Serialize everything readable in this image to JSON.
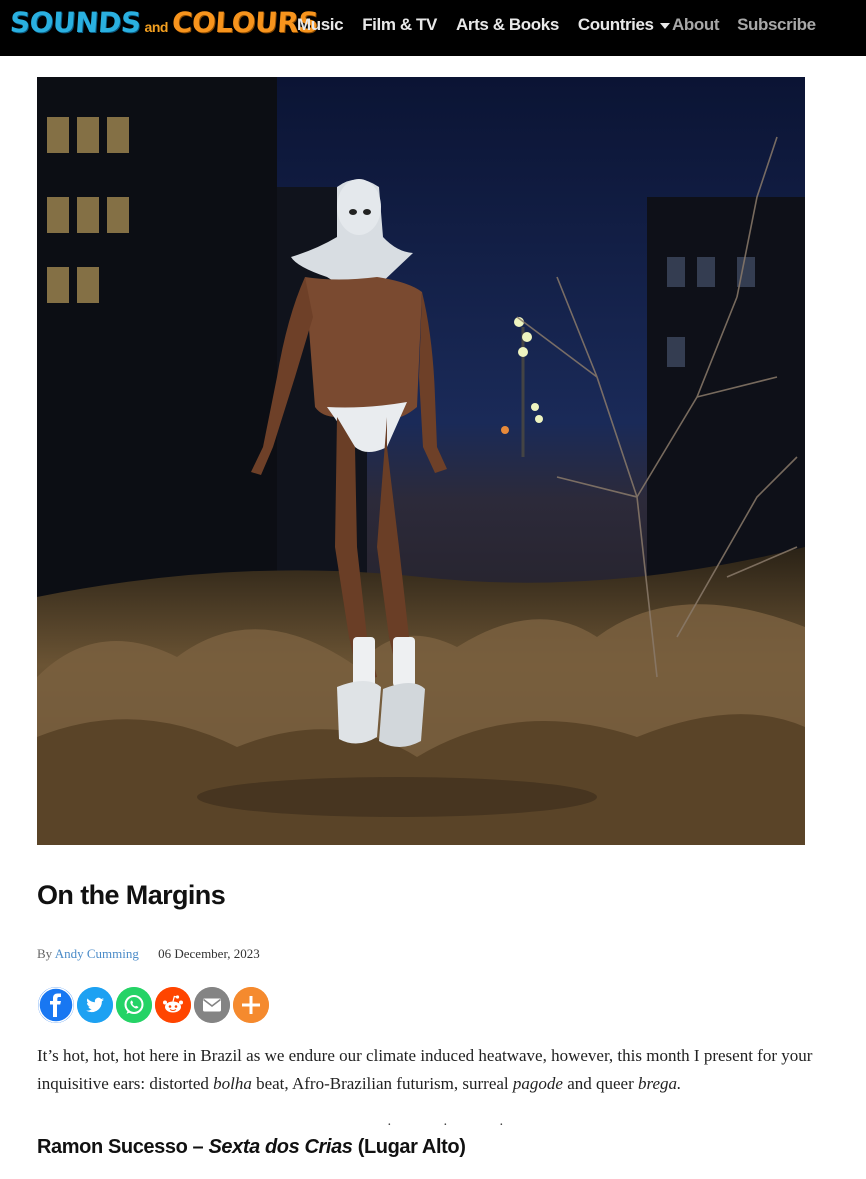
{
  "brand": {
    "word1": "SOUNDS",
    "word2": "and",
    "word3": "COLOURS"
  },
  "nav": {
    "main": [
      "Music",
      "Film & TV",
      "Arts & Books",
      "Countries"
    ],
    "secondary": [
      "About",
      "Subscribe"
    ]
  },
  "article": {
    "title": "On the Margins",
    "byline_prefix": "By",
    "author": "Andy Cumming",
    "date": "06 December, 2023",
    "share": [
      "facebook-icon",
      "twitter-icon",
      "whatsapp-icon",
      "reddit-icon",
      "email-icon",
      "more-icon"
    ],
    "share_colors": [
      "#1877f2",
      "#1da1f2",
      "#25d366",
      "#ff4500",
      "#848484",
      "#f58a2e"
    ],
    "lead": {
      "p1": "It’s hot, hot, hot here in Brazil as we endure our climate induced heatwave, however, this month I present for your inquisitive ears: distorted ",
      "em1": "bolha",
      "p2": " beat, Afro-Brazilian futurism, surreal ",
      "em2": "pagode",
      "p3": " and queer ",
      "em3": "brega."
    },
    "subhead": {
      "artist": "Ramon Sucesso – ",
      "release": "Sexta dos Crias",
      "label": " (Lugar Alto)"
    }
  }
}
